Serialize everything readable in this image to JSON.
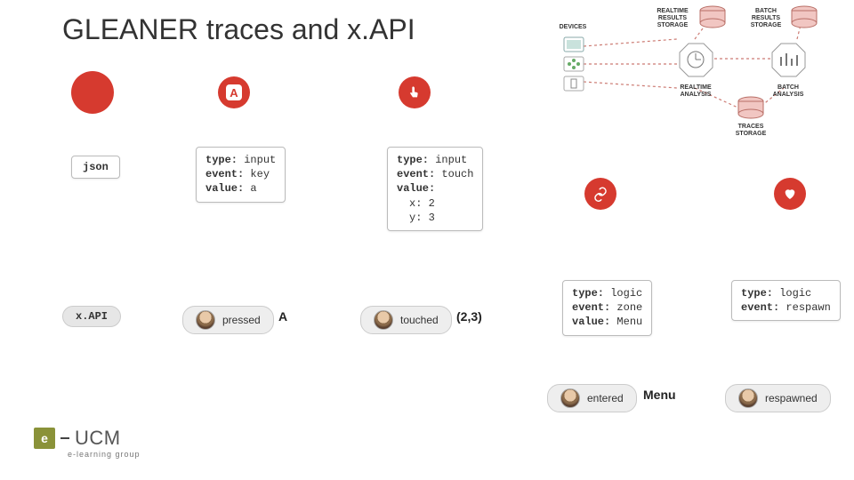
{
  "title": "GLEANER traces and x.API",
  "arch": {
    "devices_label": "DEVICES",
    "rt_results": "REALTIME RESULTS STORAGE",
    "batch_results": "BATCH RESULTS STORAGE",
    "rt_analysis": "REALTIME ANALYSIS",
    "batch_analysis": "BATCH ANALYSIS",
    "traces_storage": "TRACES STORAGE"
  },
  "icons": {
    "letter": "A"
  },
  "cards": {
    "json_label": "json",
    "input_key": {
      "type": "input",
      "event": "key",
      "value": "a"
    },
    "input_touch": {
      "type": "input",
      "event": "touch",
      "value_label": "value:",
      "x": "2",
      "y": "3"
    },
    "logic_zone": {
      "type": "logic",
      "event": "zone",
      "value": "Menu"
    },
    "logic_respawn": {
      "type": "logic",
      "event": "respawn"
    }
  },
  "pills": {
    "xapi": "x.API",
    "pressed": "pressed",
    "touched": "touched",
    "entered": "entered",
    "respawned": "respawned"
  },
  "emph": {
    "A": "A",
    "coords": "(2,3)",
    "menu": "Menu"
  },
  "logo": {
    "e": "e",
    "main": "UCM",
    "sub": "e-learning group"
  }
}
